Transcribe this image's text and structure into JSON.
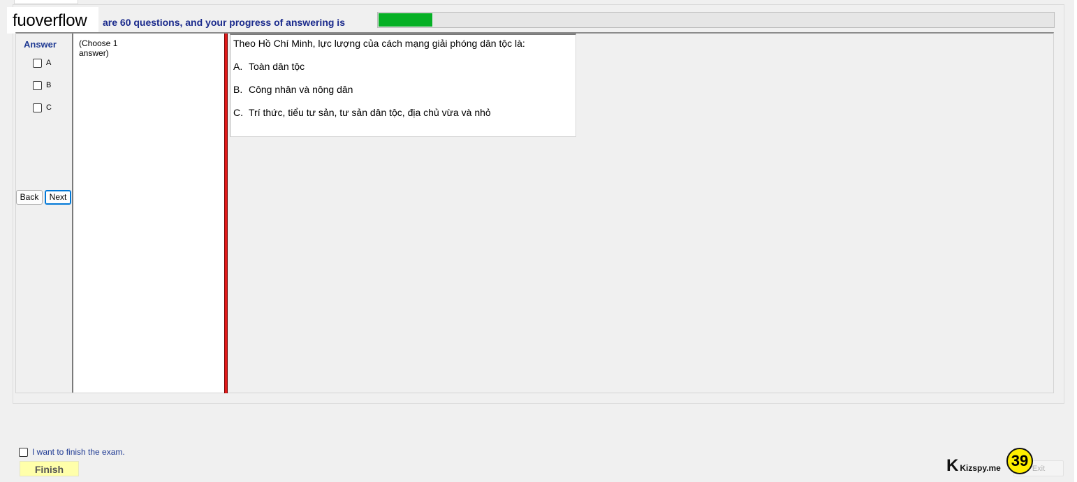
{
  "watermark": "fuoverflow",
  "progress": {
    "label": "are 60 questions, and your progress of answering is",
    "fraction": 0.08,
    "fill_color": "#06b025"
  },
  "answer": {
    "title": "Answer",
    "options": [
      "A",
      "B",
      "C"
    ]
  },
  "navigation": {
    "back_label": "Back",
    "next_label": "Next"
  },
  "instruction": "(Choose 1 answer)",
  "question": {
    "text": "Theo Hồ Chí Minh, lực lượng của cách mạng giải phóng dân tộc là:",
    "options": [
      {
        "letter": "A.",
        "text": "Toàn dân tộc"
      },
      {
        "letter": "B.",
        "text": "Công nhân và nông dân"
      },
      {
        "letter": "C.",
        "text": "Trí thức, tiểu tư sản, tư sản dân tộc, địa chủ vừa và nhỏ"
      }
    ]
  },
  "finish": {
    "checkbox_label": "I want to finish the exam.",
    "button_label": "Finish"
  },
  "branding": {
    "logo_letter": "K",
    "logo_text": "Kizspy.me"
  },
  "counter": "39",
  "exit_label": "Exit"
}
